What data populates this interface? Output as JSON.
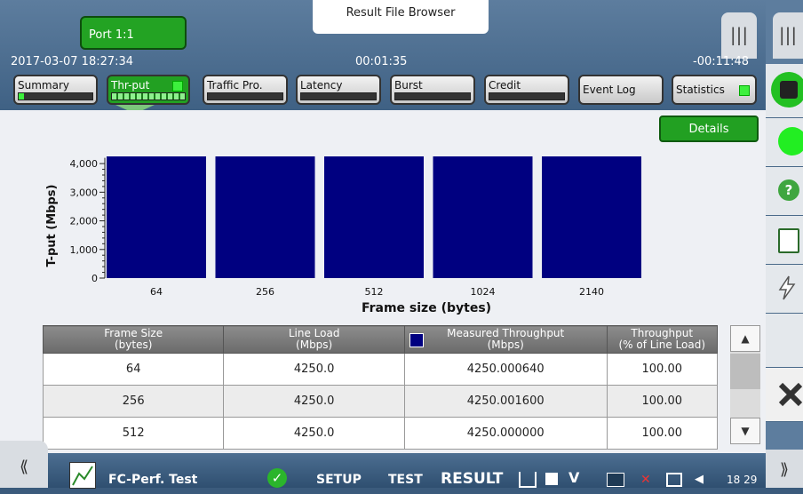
{
  "header": {
    "port_label": "Port 1:1",
    "result_browser_label": "Result File Browser",
    "menu_icon": "|||",
    "datetime": "2017-03-07 18:27:34",
    "elapsed": "00:01:35",
    "remaining": "-00:11:48"
  },
  "tabs": [
    {
      "label": "Summary"
    },
    {
      "label": "Thr-put"
    },
    {
      "label": "Traffic Pro."
    },
    {
      "label": "Latency"
    },
    {
      "label": "Burst"
    },
    {
      "label": "Credit"
    },
    {
      "label": "Event Log"
    },
    {
      "label": "Statistics"
    }
  ],
  "details_label": "Details",
  "chart_data": {
    "type": "bar",
    "categories": [
      "64",
      "256",
      "512",
      "1024",
      "2140"
    ],
    "values": [
      4250.00064,
      4250.0016,
      4250.0,
      4250.0,
      4250.0
    ],
    "xlabel": "Frame size (bytes)",
    "ylabel": "T-put (Mbps)",
    "yticks": [
      "0",
      "1,000",
      "2,000",
      "3,000",
      "4,000"
    ],
    "ylim": [
      0,
      4500
    ],
    "bar_color": "#000080"
  },
  "table": {
    "headers": [
      {
        "line1": "Frame Size",
        "line2": "(bytes)"
      },
      {
        "line1": "Line Load",
        "line2": "(Mbps)"
      },
      {
        "line1": "Measured Throughput",
        "line2": "(Mbps)"
      },
      {
        "line1": "Throughput",
        "line2": "(% of Line Load)"
      }
    ],
    "rows": [
      [
        "64",
        "4250.0",
        "4250.000640",
        "100.00"
      ],
      [
        "256",
        "4250.0",
        "4250.001600",
        "100.00"
      ],
      [
        "512",
        "4250.0",
        "4250.000000",
        "100.00"
      ]
    ]
  },
  "scroll": {
    "up": "▲",
    "down": "▼"
  },
  "right_panel": {
    "help": "?"
  },
  "bottom": {
    "left_arrow": "⟪",
    "right_arrow": "⟫",
    "app_name": "FC-Perf. Test",
    "setup": "SETUP",
    "test": "TEST",
    "result": "RESULT",
    "time": "18 29"
  }
}
